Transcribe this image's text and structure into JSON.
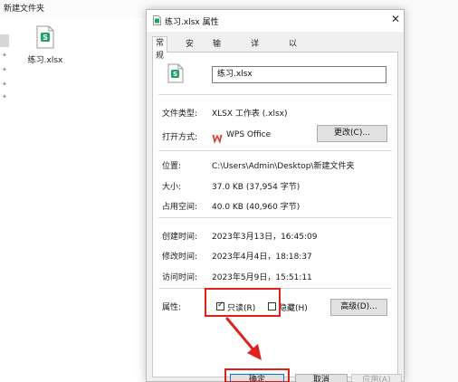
{
  "explorer": {
    "window_title": "新建文件夹",
    "file_label": "练习.xlsx"
  },
  "dialog": {
    "title": "练习.xlsx 属性",
    "close_glyph": "✕",
    "tabs": [
      {
        "label": "常规",
        "active": true
      },
      {
        "label": "安全",
        "active": false
      },
      {
        "label": "输出转换",
        "active": false
      },
      {
        "label": "详细信息",
        "active": false
      },
      {
        "label": "以前的版本",
        "active": false
      }
    ],
    "file_name": "练习.xlsx",
    "rows": {
      "type": {
        "label": "文件类型:",
        "value": "XLSX 工作表 (.xlsx)"
      },
      "open_with": {
        "label": "打开方式:",
        "value": "WPS Office",
        "button": "更改(C)..."
      },
      "location": {
        "label": "位置:",
        "value": "C:\\Users\\Admin\\Desktop\\新建文件夹"
      },
      "size": {
        "label": "大小:",
        "value": "37.0 KB (37,954 字节)"
      },
      "size_on_disk": {
        "label": "占用空间:",
        "value": "40.0 KB (40,960 字节)"
      },
      "created": {
        "label": "创建时间:",
        "value": "2023年3月13日，16:45:09"
      },
      "modified": {
        "label": "修改时间:",
        "value": "2023年4月4日，18:18:37"
      },
      "accessed": {
        "label": "访问时间:",
        "value": "2023年5月9日，15:51:11"
      }
    },
    "attributes": {
      "label": "属性:",
      "readonly_label": "只读(R)",
      "readonly_checked": true,
      "hidden_label": "隐藏(H)",
      "hidden_checked": false,
      "advanced_button": "高级(D)..."
    },
    "footer": {
      "ok": "确定",
      "cancel": "取消",
      "apply": "应用(A)"
    }
  },
  "colors": {
    "annotation": "#e0201b",
    "excel_green": "#21a366",
    "wps_red": "#e03a2f"
  }
}
